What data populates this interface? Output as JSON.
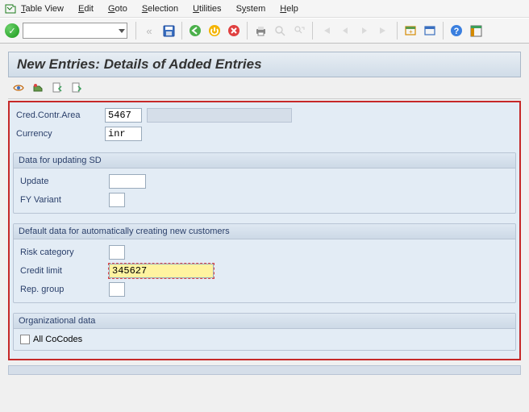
{
  "menu": {
    "items": [
      {
        "label": "Table View",
        "ul_start": 0,
        "ul_end": 1
      },
      {
        "label": "Edit",
        "ul_start": 0,
        "ul_end": 1
      },
      {
        "label": "Goto",
        "ul_start": 0,
        "ul_end": 1
      },
      {
        "label": "Selection",
        "ul_start": 0,
        "ul_end": 1
      },
      {
        "label": "Utilities",
        "ul_start": 0,
        "ul_end": 1
      },
      {
        "label": "System",
        "ul_start": 1,
        "ul_end": 2
      },
      {
        "label": "Help",
        "ul_start": 0,
        "ul_end": 1
      }
    ]
  },
  "title": "New Entries: Details of Added Entries",
  "header_fields": {
    "cred_contr_area_label": "Cred.Contr.Area",
    "cred_contr_area_value": "5467",
    "currency_label": "Currency",
    "currency_value": "inr"
  },
  "section_sd": {
    "title": "Data for updating SD",
    "update_label": "Update",
    "update_value": "",
    "fy_variant_label": "FY Variant",
    "fy_variant_value": ""
  },
  "section_default": {
    "title": "Default data for automatically creating new customers",
    "risk_category_label": "Risk category",
    "risk_category_value": "",
    "credit_limit_label": "Credit limit",
    "credit_limit_value": "345627",
    "rep_group_label": "Rep. group",
    "rep_group_value": ""
  },
  "section_org": {
    "title": "Organizational data",
    "all_cocodes_label": "All CoCodes",
    "all_cocodes_checked": false
  }
}
